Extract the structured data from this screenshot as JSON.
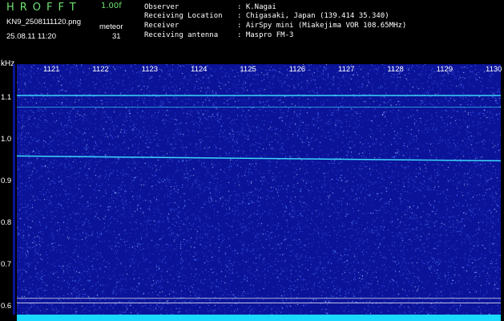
{
  "header": {
    "app_title": "HROFFT",
    "version": "1.00f",
    "file_name": "KN9_2508111120.png",
    "timestamp": "25.08.11 11:20",
    "meteor_label": "meteor",
    "meteor_count": "31"
  },
  "info": [
    {
      "label": "Observer",
      "value": ": K.Nagai"
    },
    {
      "label": "Receiving Location",
      "value": ": Chigasaki, Japan (139.414 35.340)"
    },
    {
      "label": "Receiver",
      "value": ": AirSpy mini (Miakejima VOR 108.65MHz)"
    },
    {
      "label": "Receiving antenna",
      "value": ": Maspro FM-3"
    }
  ],
  "chart_data": {
    "type": "heatmap",
    "yunit": "kHz",
    "x_ticks": [
      "1121",
      "1122",
      "1123",
      "1124",
      "1125",
      "1126",
      "1127",
      "1128",
      "1129",
      "1130"
    ],
    "y_ticks": [
      "1.1",
      "1.0",
      "0.9",
      "0.8",
      "0.7",
      "0.6"
    ],
    "ylim": [
      0.58,
      1.18
    ],
    "carrier_lines_khz": [
      1.105,
      1.077,
      0.96
    ],
    "reference_lines_khz": [
      0.619,
      0.608
    ],
    "colors": {
      "background": "#0b1399",
      "noise": "#4f7dff",
      "signal": "#3fe0ff",
      "baseline": "#19d9ff",
      "reference": "#ffffff"
    }
  }
}
